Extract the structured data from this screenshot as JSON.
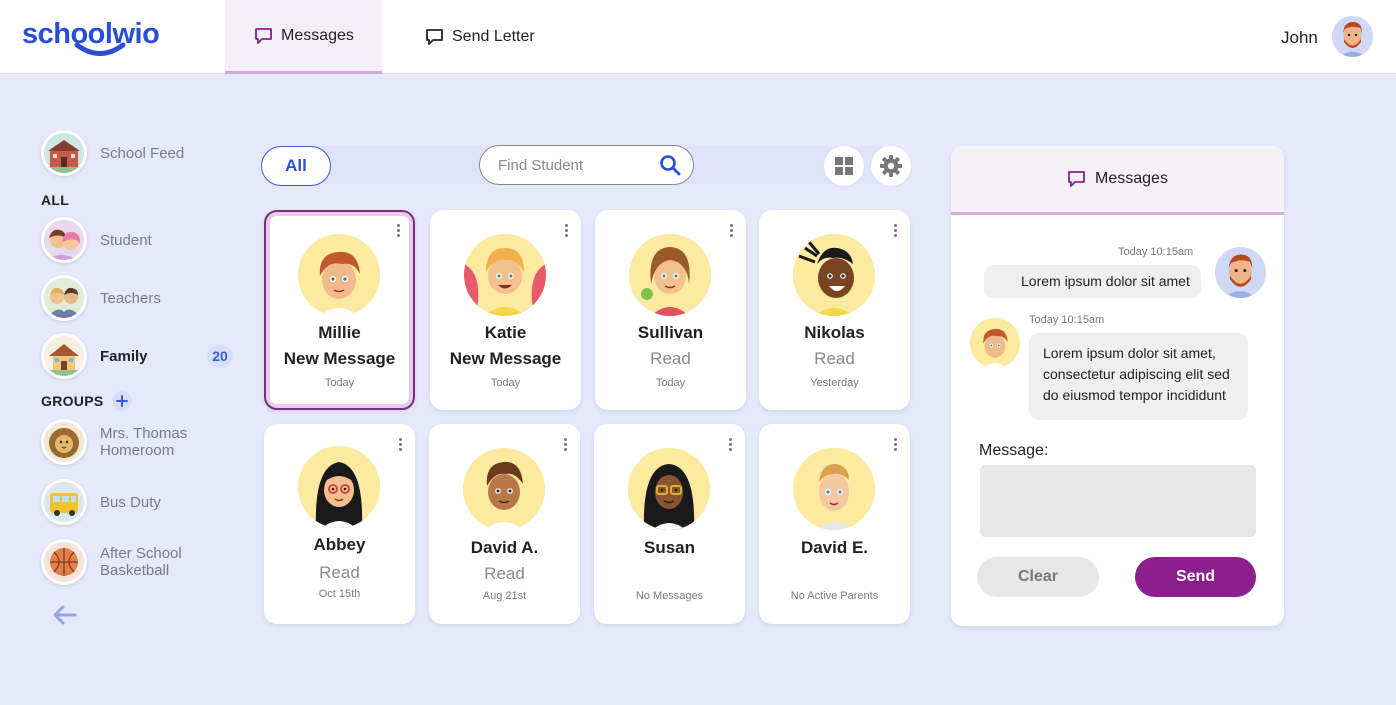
{
  "app": {
    "logo": "schoolwio",
    "accent": "#2a4fd6",
    "brand_purple": "#8a1f8d"
  },
  "header": {
    "tabs": [
      {
        "label": "Messages",
        "icon": "chat-bubble-icon",
        "active": true
      },
      {
        "label": "Send Letter",
        "icon": "chat-bubble-icon",
        "active": false
      }
    ],
    "user_name": "John"
  },
  "sidebar": {
    "feed": {
      "label": "School Feed",
      "icon": "school-building-avatar"
    },
    "all_heading": "ALL",
    "all_items": [
      {
        "label": "Student"
      },
      {
        "label": "Teachers"
      },
      {
        "label": "Family",
        "badge": "20",
        "active": true
      }
    ],
    "groups_heading": "GROUPS",
    "groups": [
      {
        "label": "Mrs. Thomas Homeroom"
      },
      {
        "label": "Bus Duty"
      },
      {
        "label": "After School Basketball"
      }
    ]
  },
  "toolbar": {
    "filter_label": "All",
    "search_placeholder": "Find Student"
  },
  "students": [
    {
      "name": "Millie",
      "status": "New Message",
      "date": "Today",
      "selected": true
    },
    {
      "name": "Katie",
      "status": "New Message",
      "date": "Today"
    },
    {
      "name": "Sullivan",
      "status": "Read",
      "date": "Today"
    },
    {
      "name": "Nikolas",
      "status": "Read",
      "date": "Yesterday"
    },
    {
      "name": "Abbey",
      "status": "Read",
      "date": "Oct 15th"
    },
    {
      "name": "David A.",
      "status": "Read",
      "date": "Aug 21st"
    },
    {
      "name": "Susan",
      "status": "",
      "date": "No Messages"
    },
    {
      "name": "David E.",
      "status": "",
      "date": "No Active Parents"
    }
  ],
  "messages_panel": {
    "title": "Messages",
    "thread": [
      {
        "time": "Today 10:15am",
        "text": "Lorem ipsum dolor sit amet",
        "from": "user"
      },
      {
        "time": "Today 10:15am",
        "text": "Lorem ipsum dolor sit amet, consectetur adipiscing elit sed do eiusmod tempor incididunt",
        "from": "student"
      }
    ],
    "message_label": "Message:",
    "message_value": "",
    "clear_label": "Clear",
    "send_label": "Send"
  }
}
